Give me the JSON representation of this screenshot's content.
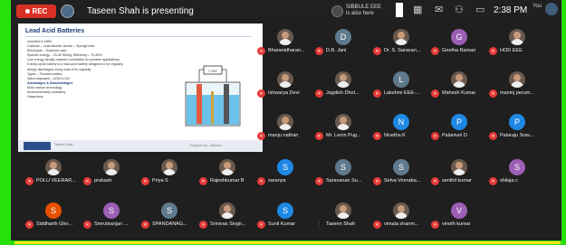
{
  "topbar": {
    "rec_label": "REC",
    "presenting_text": "Taseen Shah is presenting",
    "also_here_name": "SIBBULE EEE",
    "also_here_text": "is also here",
    "time": "2:38 PM",
    "self_label": "You",
    "icons": [
      "grid-icon",
      "chat-bubbles-icon",
      "people-icon",
      "screen-share-icon"
    ]
  },
  "slide": {
    "title": "Lead Acid Batteries",
    "bullets": [
      "Invented in 1859.",
      "Cathode – Lead dioxide, Anode – Sponge lead",
      "Electrolyte – Sulphuric acid",
      "Specific energy – 33-42 Wh/kg, Efficiency – 70-80%",
      "Low energy density makes it unsuitable for portable applications.",
      "A deep-cycle battery is a lead-acid battery designed to be regularly",
      "deeply discharged  using most of its capacity",
      "Types – Flooded battery",
      "Valve-regulated – AGM & Gel"
    ],
    "advantages_heading": "Advantages & Disadvantages",
    "advantages": [
      "Most mature technology",
      "Environmentally unhealthy",
      "Hazardous"
    ],
    "diagram_label": "Load",
    "footer_left": "Taseen Shah",
    "footer_right": "Prepared by - Abhinav"
  },
  "participants": [
    {
      "name": "Bharanidharan...",
      "type": "photo"
    },
    {
      "name": "D.B. Jani",
      "type": "letter",
      "letter": "D",
      "color": "#5f7a8c"
    },
    {
      "name": "Dr. S. Saravan...",
      "type": "photo"
    },
    {
      "name": "Geetha Raman",
      "type": "letter",
      "letter": "G",
      "color": "#9c5fb5"
    },
    {
      "name": "HOD EEE",
      "type": "photo"
    },
    {
      "name": "Ishwarya Devi",
      "type": "photo"
    },
    {
      "name": "Jagdish Dhol...",
      "type": "photo"
    },
    {
      "name": "Lakshmi EEE-...",
      "type": "letter",
      "letter": "L",
      "color": "#5f7a8c"
    },
    {
      "name": "Mahesh Kumar",
      "type": "photo"
    },
    {
      "name": "maninj perum...",
      "type": "photo"
    },
    {
      "name": "manju nathan",
      "type": "photo"
    },
    {
      "name": "Mr. Lenin Pug...",
      "type": "photo"
    },
    {
      "name": "Nivetha K",
      "type": "letter",
      "letter": "N",
      "color": "#1e88e5"
    },
    {
      "name": "Palanivel D",
      "type": "letter",
      "letter": "P",
      "color": "#1e88e5"
    },
    {
      "name": "Palaraju Srav...",
      "type": "letter",
      "letter": "P",
      "color": "#1e88e5"
    },
    {
      "name": "POLU VEERAR...",
      "type": "photo"
    },
    {
      "name": "prakash",
      "type": "photo"
    },
    {
      "name": "Priya S",
      "type": "photo"
    },
    {
      "name": "Rajeshkumar B",
      "type": "photo"
    },
    {
      "name": "saranya",
      "type": "letter",
      "letter": "S",
      "color": "#1e88e5"
    },
    {
      "name": "Saravanan Su...",
      "type": "letter",
      "letter": "S",
      "color": "#5f7a8c"
    },
    {
      "name": "Selva Veeraba...",
      "type": "letter",
      "letter": "S",
      "color": "#5f7a8c"
    },
    {
      "name": "senthil kumar",
      "type": "photo"
    },
    {
      "name": "shilaja c",
      "type": "letter",
      "letter": "S",
      "color": "#9c5fb5"
    },
    {
      "name": "Siddharth Gho...",
      "type": "letter",
      "letter": "S",
      "color": "#e65100"
    },
    {
      "name": "Smrutiranjan ...",
      "type": "letter",
      "letter": "S",
      "color": "#9c5fb5"
    },
    {
      "name": "SPANDANAG...",
      "type": "letter",
      "letter": "S",
      "color": "#5f7a8c"
    },
    {
      "name": "Srinivas Singir...",
      "type": "photo"
    },
    {
      "name": "Sunil Kumar",
      "type": "letter",
      "letter": "S",
      "color": "#1e88e5"
    },
    {
      "name": "Taseen Shah",
      "type": "photo",
      "speaking": true
    },
    {
      "name": "vimala shanm...",
      "type": "photo"
    },
    {
      "name": "vinoth kumar",
      "type": "letter",
      "letter": "V",
      "color": "#9c5fb5"
    }
  ]
}
